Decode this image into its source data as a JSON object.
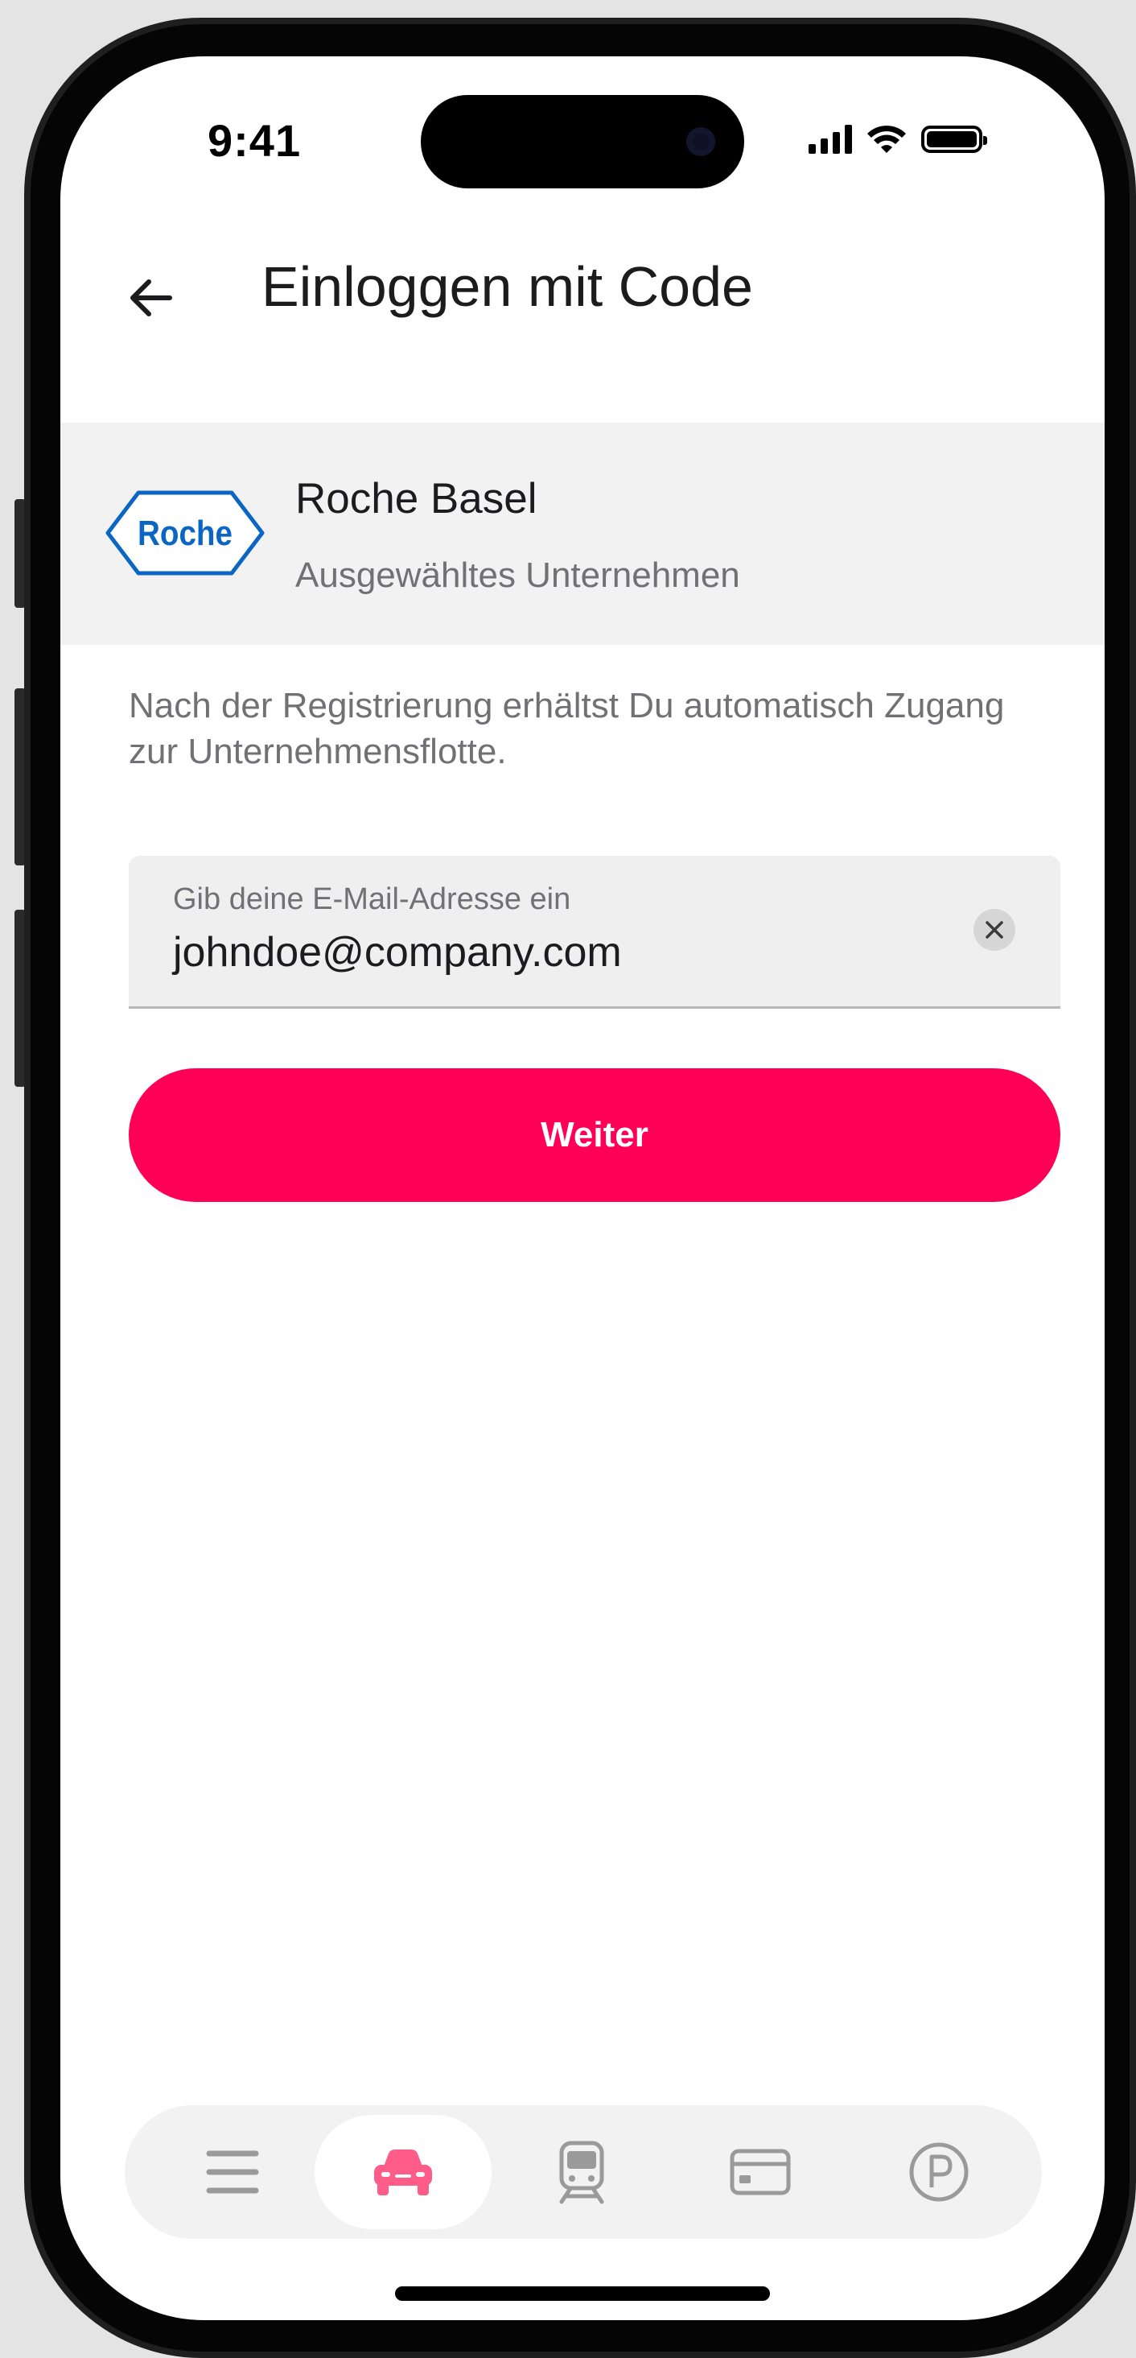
{
  "status_bar": {
    "time": "9:41",
    "icons": [
      "cellular-signal-icon",
      "wifi-icon",
      "battery-icon"
    ]
  },
  "header": {
    "back_icon": "arrow-left-icon",
    "title": "Einloggen mit Code"
  },
  "company": {
    "logo_text": "Roche",
    "name": "Roche Basel",
    "subtitle": "Ausgewähltes Unternehmen",
    "logo_color": "#0b66c3"
  },
  "info_text": "Nach der Registrierung erhältst Du automatisch Zugang zur Unternehmensflotte.",
  "email_field": {
    "label": "Gib deine E-Mail-Adresse ein",
    "value": "johndoe@company.com",
    "clear_icon": "close-icon"
  },
  "primary_button": {
    "label": "Weiter",
    "color": "#fe0055"
  },
  "tab_bar": {
    "active_index": 1,
    "tabs": [
      {
        "icon": "menu-icon"
      },
      {
        "icon": "car-icon"
      },
      {
        "icon": "train-icon"
      },
      {
        "icon": "card-icon"
      },
      {
        "icon": "parking-icon"
      }
    ]
  },
  "colors": {
    "accent": "#fe0055",
    "active_tab_icon": "#ff5c8a",
    "inactive_tab_icon": "#9a9a9a"
  }
}
